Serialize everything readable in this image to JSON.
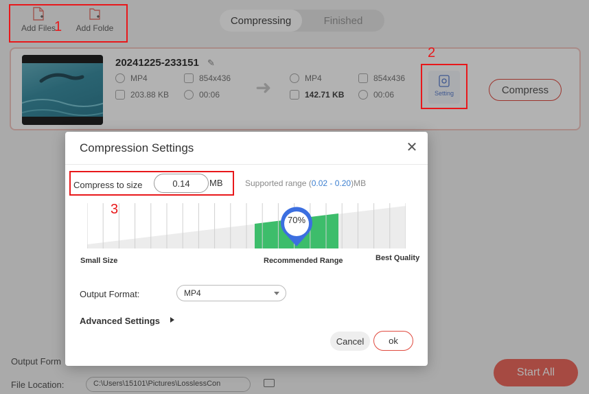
{
  "toolbar": {
    "add_files": "Add Files",
    "add_folder": "Add Folde"
  },
  "tabs": {
    "compressing": "Compressing",
    "finished": "Finished"
  },
  "file": {
    "name": "20241225-233151",
    "source": {
      "format": "MP4",
      "resolution": "854x436",
      "size": "203.88 KB",
      "duration": "00:06"
    },
    "target": {
      "format": "MP4",
      "resolution": "854x436",
      "size": "142.71 KB",
      "duration": "00:06"
    },
    "setting_label": "Setting",
    "compress_label": "Compress"
  },
  "footer": {
    "output_format_label": "Output Form",
    "file_location_label": "File Location:",
    "file_location_value": "C:\\Users\\15101\\Pictures\\LosslessCon",
    "start_all": "Start All"
  },
  "dialog": {
    "title": "Compression Settings",
    "size_label": "Compress to size",
    "size_value": "0.14",
    "size_unit": "MB",
    "range_prefix": "Supported range (",
    "range_values": "0.02 - 0.20",
    "range_suffix": ")MB",
    "percent": "70%",
    "percent_value": 0.7,
    "slider_labels": {
      "small": "Small Size",
      "recommended": "Recommended Range",
      "best": "Best Quality"
    },
    "output_format_label": "Output Format:",
    "output_format_value": "MP4",
    "advanced": "Advanced Settings",
    "cancel": "Cancel",
    "ok": "ok"
  },
  "annotations": [
    "1",
    "2",
    "3"
  ],
  "colors": {
    "accent_red": "#e04a3f",
    "annotation_red": "#e8171a",
    "recommended_green": "#3dbd6b",
    "knob_blue": "#3c6fe0"
  }
}
